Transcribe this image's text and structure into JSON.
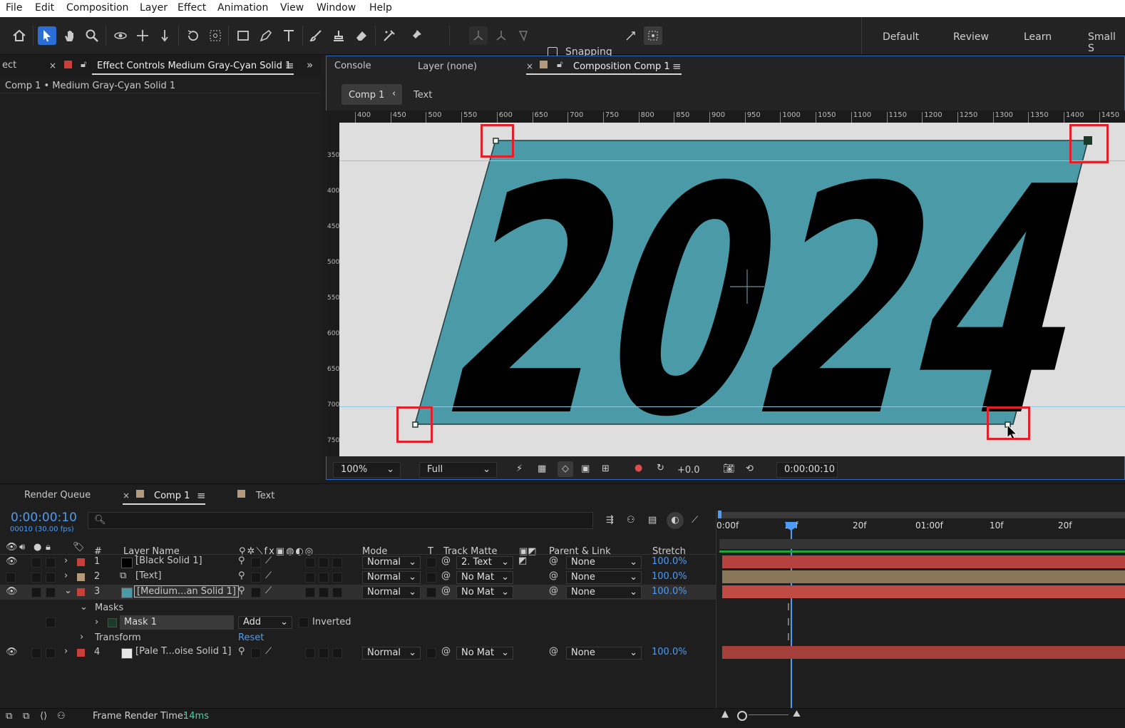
{
  "menu": [
    "File",
    "Edit",
    "Composition",
    "Layer",
    "Effect",
    "Animation",
    "View",
    "Window",
    "Help"
  ],
  "toolbar": {
    "tools": [
      "home-icon",
      "selection-arrow-icon",
      "hand-icon",
      "zoom-icon",
      "orbit-camera-icon",
      "pan-camera-icon",
      "dolly-camera-icon",
      "rotate-icon",
      "anchor-point-icon",
      "rectangle-icon",
      "pen-icon",
      "type-icon",
      "brush-icon",
      "clone-stamp-icon",
      "eraser-icon",
      "roto-brush-icon",
      "puppet-pin-icon"
    ],
    "snapping_label": "Snapping",
    "workspaces": [
      "Default",
      "Review",
      "Learn",
      "Small S"
    ]
  },
  "left_panel": {
    "tab_truncated": "ect",
    "tab_title": "Effect Controls Medium Gray-Cyan Solid 1",
    "tab_color": "#c9403a",
    "subtitle": "Comp 1 • Medium Gray-Cyan Solid 1"
  },
  "viewer_tabs": {
    "console": "Console",
    "layer": "Layer (none)",
    "composition": "Composition Comp 1",
    "comp_color": "#b39a7a"
  },
  "breadcrumbs": [
    "Comp 1",
    "Text"
  ],
  "ruler_h": [
    "400",
    "450",
    "500",
    "550",
    "600",
    "650",
    "700",
    "750",
    "800",
    "850",
    "900",
    "950",
    "1000",
    "1050",
    "1100",
    "1150",
    "1200",
    "1250",
    "1300",
    "1350",
    "1400",
    "1450"
  ],
  "ruler_v": [
    "350",
    "400",
    "450",
    "500",
    "550",
    "600",
    "650",
    "700",
    "750"
  ],
  "canvas": {
    "text": "2024",
    "solid_color": "#4a9aa8",
    "background": "#dedede"
  },
  "viewer_controls": {
    "zoom": "100%",
    "resolution": "Full",
    "exposure": "+0.0",
    "timecode": "0:00:00:10"
  },
  "timeline_tabs": {
    "render_queue": "Render Queue",
    "comp": "Comp 1",
    "text": "Text"
  },
  "timeline": {
    "timecode": "0:00:00:10",
    "frames": "00010 (30.00 fps)",
    "search_placeholder": "",
    "ruler_labels": [
      "0:00f",
      "10f",
      "20f",
      "01:00f",
      "10f",
      "20f"
    ],
    "columns": {
      "hash": "#",
      "layer_name": "Layer Name",
      "mode": "Mode",
      "t": "T",
      "track_matte": "Track Matte",
      "parent": "Parent & Link",
      "stretch": "Stretch"
    },
    "layers": [
      {
        "num": "1",
        "name": "[Black Solid 1]",
        "color": "#c9403a",
        "swatch": "#000000",
        "mode": "Normal",
        "matte": "2. Text",
        "parent": "None",
        "stretch": "100.0%",
        "bar": "#b5423e"
      },
      {
        "num": "2",
        "name": "[Text]",
        "color": "#b39a7a",
        "swatch": "",
        "mode": "Normal",
        "matte": "No Mat",
        "parent": "None",
        "stretch": "100.0%",
        "bar": "#8a7658"
      },
      {
        "num": "3",
        "name": "[Medium...an Solid 1]",
        "color": "#c9403a",
        "swatch": "#4a9aa8",
        "mode": "Normal",
        "matte": "No Mat",
        "parent": "None",
        "stretch": "100.0%",
        "bar": "#c04a44"
      },
      {
        "num": "4",
        "name": "[Pale T...oise Solid 1]",
        "color": "#c9403a",
        "swatch": "#e8e8e8",
        "mode": "Normal",
        "matte": "No Mat",
        "parent": "None",
        "stretch": "100.0%",
        "bar": "#a43f3b"
      }
    ],
    "masks_label": "Masks",
    "mask_name": "Mask 1",
    "mask_mode": "Add",
    "inverted_label": "Inverted",
    "transform_label": "Transform",
    "reset_label": "Reset"
  },
  "status": {
    "label": "Frame Render Time:",
    "value": "14ms"
  }
}
